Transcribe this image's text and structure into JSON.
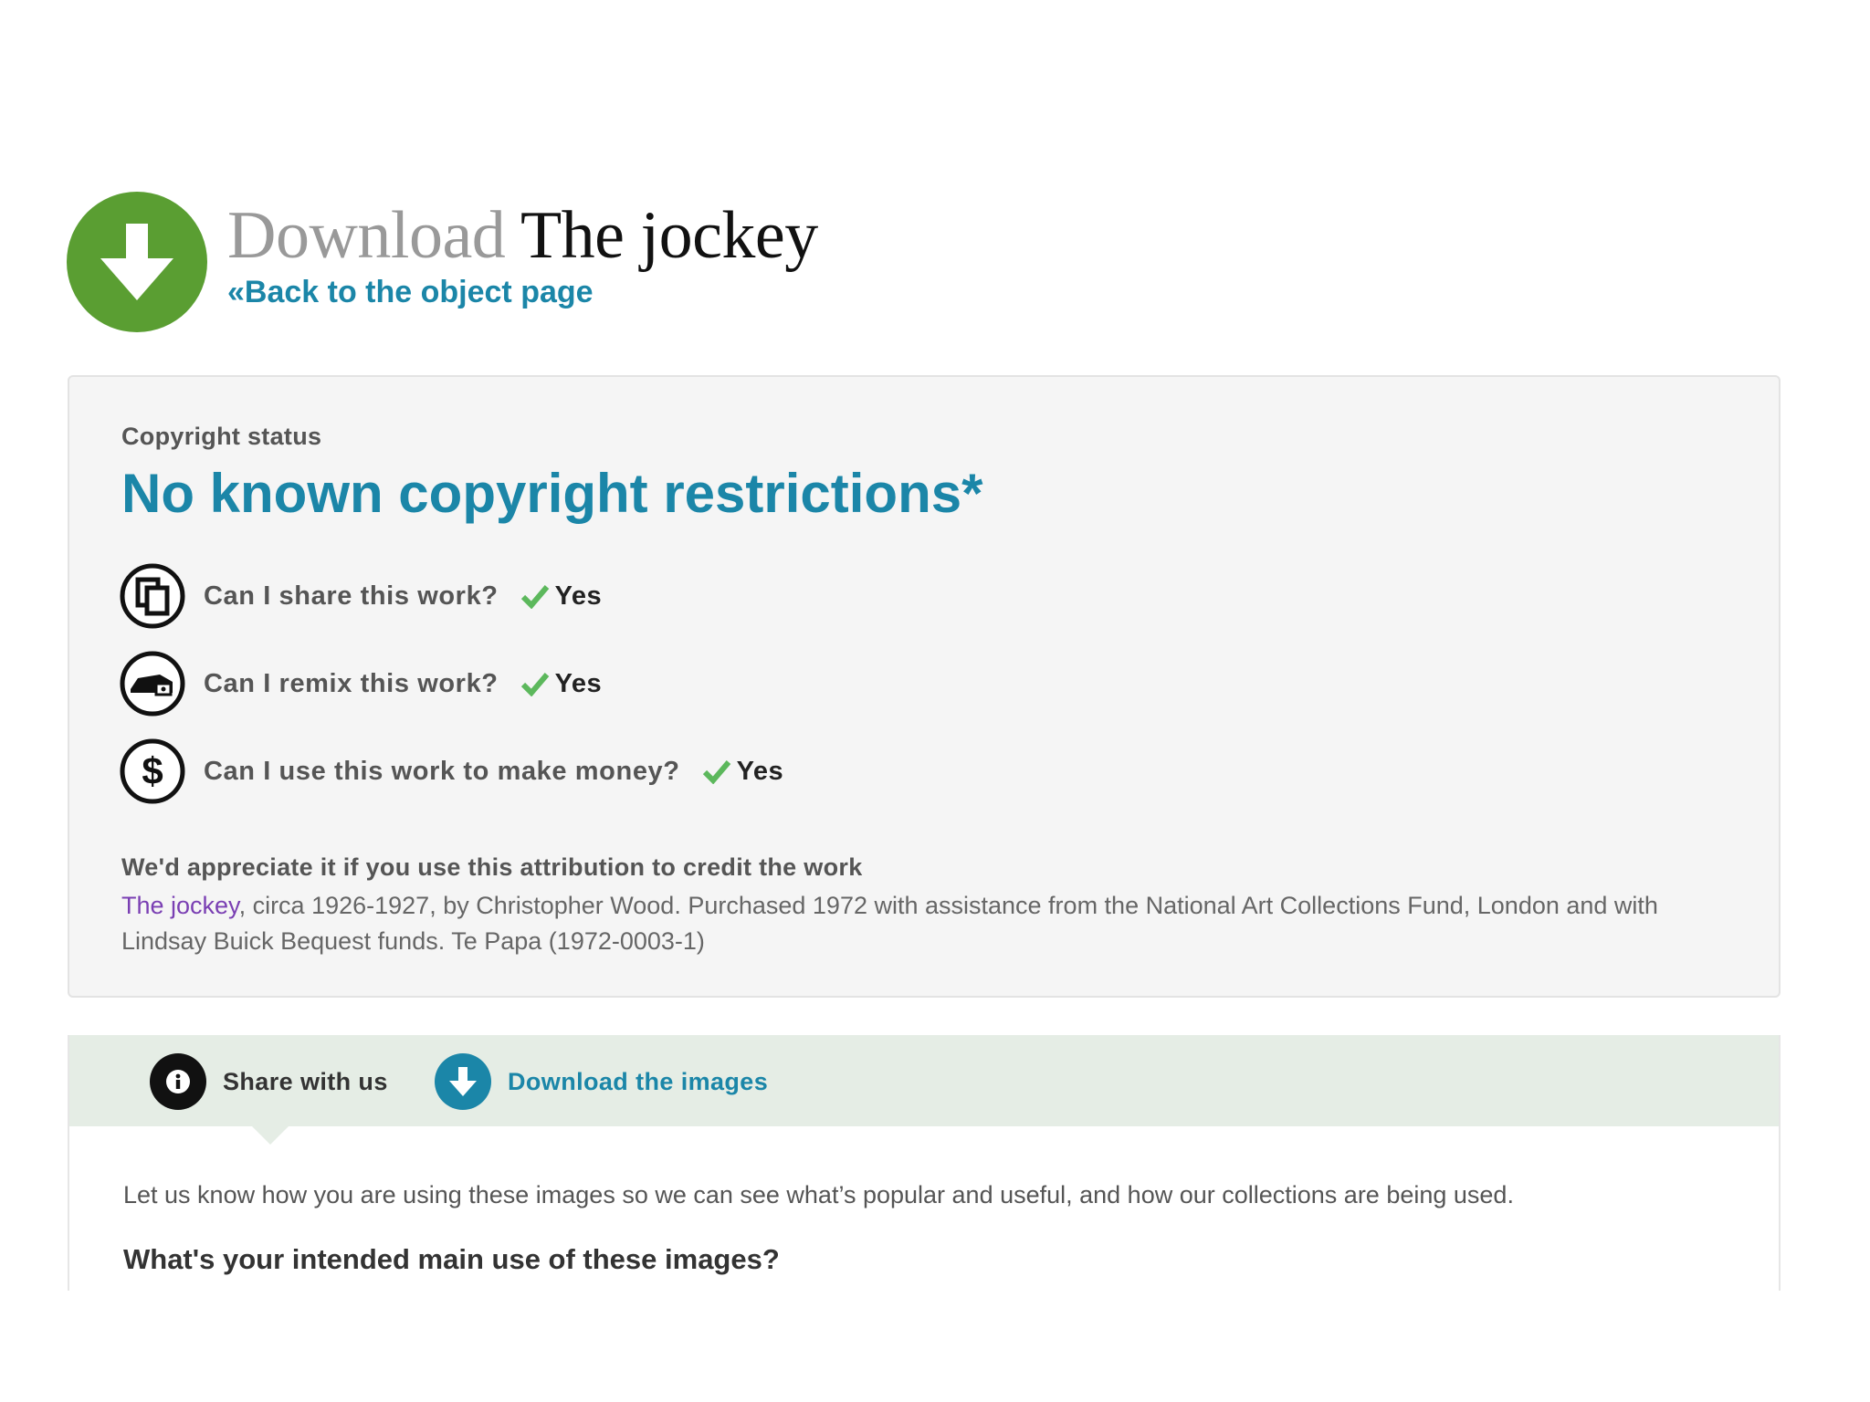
{
  "header": {
    "title_prefix": "Download",
    "title_name": "The jockey",
    "back_link": "«Back to the object page",
    "icon": "download-arrow-icon",
    "accent_color": "#5a9e32"
  },
  "copyright": {
    "label": "Copyright status",
    "value": "No known copyright restrictions*",
    "questions": [
      {
        "icon": "share-icon",
        "question": "Can I share this work?",
        "answer": "Yes"
      },
      {
        "icon": "remix-icon",
        "question": "Can I remix this work?",
        "answer": "Yes"
      },
      {
        "icon": "dollar-icon",
        "question": "Can I use this work to make money?",
        "answer": "Yes"
      }
    ],
    "attribution_heading": "We'd appreciate it if you use this attribution to credit the work",
    "attribution_link": "The jockey",
    "attribution_rest": ", circa 1926-1927, by Christopher Wood. Purchased 1972 with assistance from the National Art Collections Fund, London and with Lindsay Buick Bequest funds. Te Papa (1972-0003-1)"
  },
  "tabs": {
    "items": [
      {
        "label": "Share with us",
        "icon": "info-icon",
        "active": true
      },
      {
        "label": "Download the images",
        "icon": "download-icon",
        "active": false
      }
    ],
    "intro": "Let us know how you are using these images so we can see what’s popular and useful, and how our collections are being used.",
    "question": "What's your intended main use of these images?"
  },
  "colors": {
    "link_blue": "#1b86a8",
    "check_green": "#5cb85c",
    "tab_bar": "#e5ede5"
  }
}
